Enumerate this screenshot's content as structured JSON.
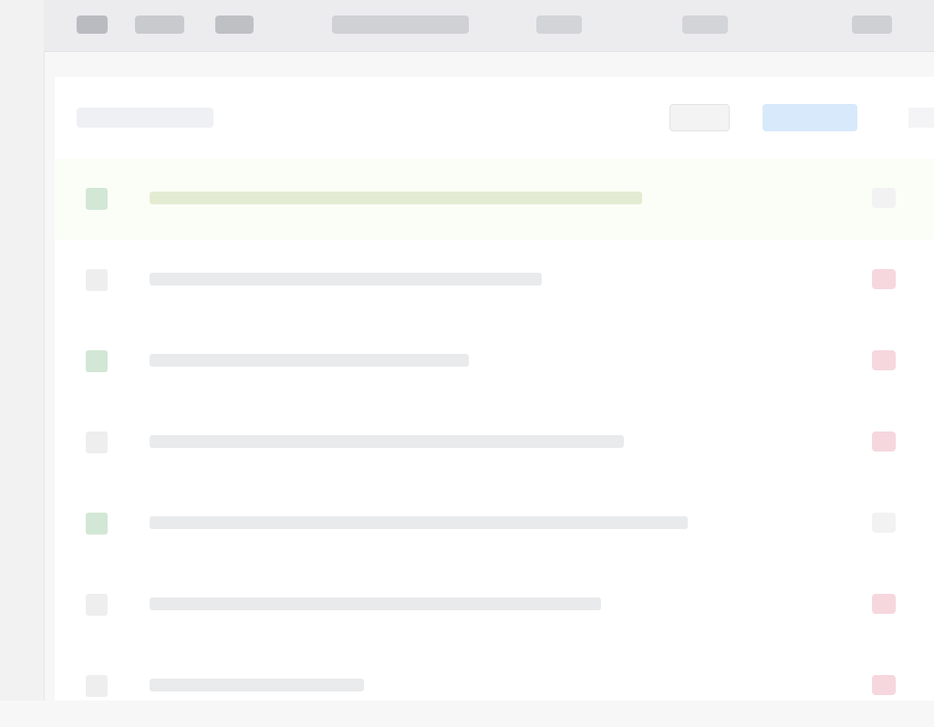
{
  "colors": {
    "status_ok": "#d2e7d5",
    "status_neutral": "#eeeeef",
    "marker_alert": "#f6d7de",
    "marker_neutral": "#f2f2f3",
    "primary_button": "#d8e9fb",
    "highlight_row": "#fbfdf7"
  },
  "toolbar": {
    "items": [
      {
        "label": "",
        "icon": "menu-icon"
      },
      {
        "label": ""
      },
      {
        "label": ""
      },
      {
        "label": ""
      },
      {
        "label": ""
      },
      {
        "label": ""
      },
      {
        "label": ""
      }
    ]
  },
  "panel": {
    "title": "",
    "secondary_button": "",
    "primary_button": ""
  },
  "rows": [
    {
      "status": "ok",
      "text": "",
      "marker": "neutral"
    },
    {
      "status": "neutral",
      "text": "",
      "marker": "alert"
    },
    {
      "status": "ok",
      "text": "",
      "marker": "alert"
    },
    {
      "status": "neutral",
      "text": "",
      "marker": "alert"
    },
    {
      "status": "ok",
      "text": "",
      "marker": "neutral"
    },
    {
      "status": "neutral",
      "text": "",
      "marker": "alert"
    },
    {
      "status": "neutral",
      "text": "",
      "marker": "alert"
    }
  ]
}
